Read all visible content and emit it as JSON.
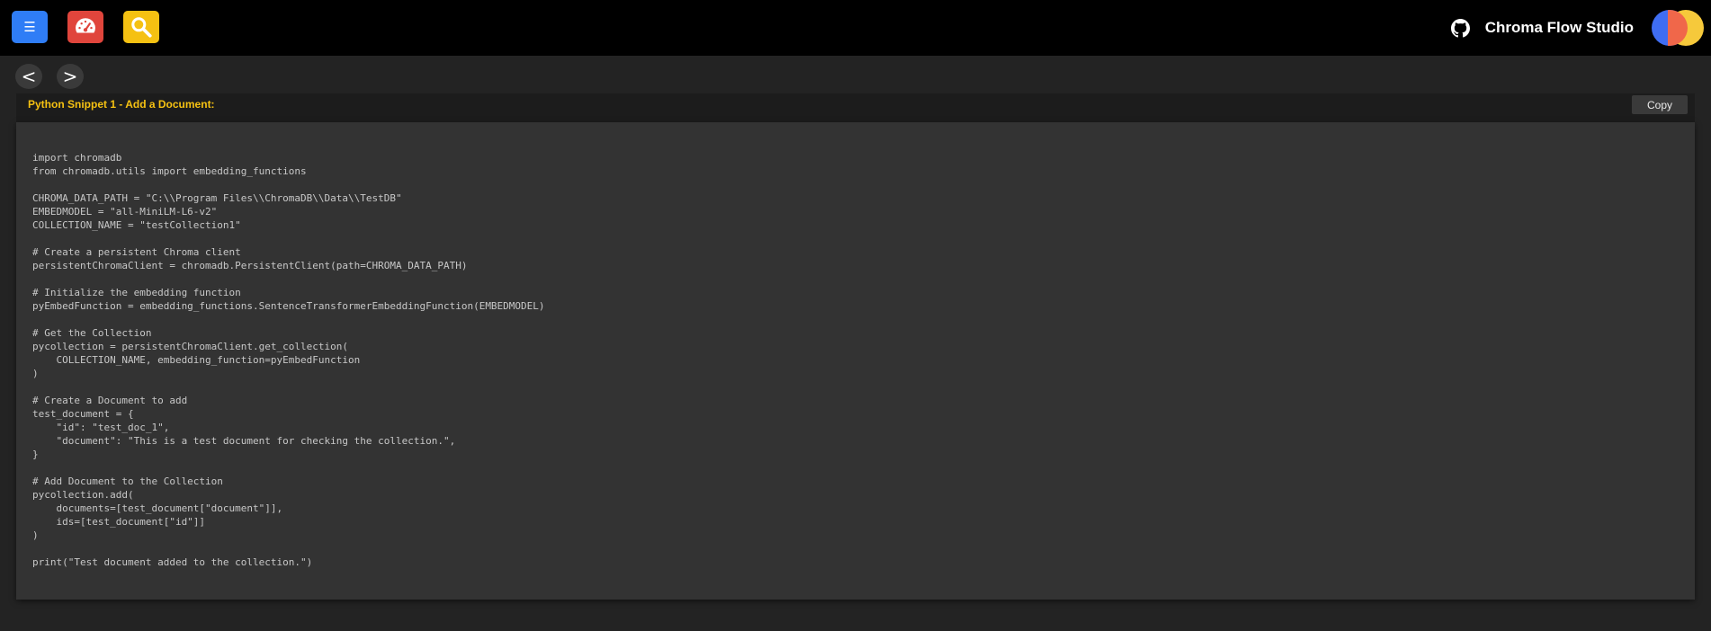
{
  "header": {
    "menu_icon": "menu-icon",
    "dashboard_icon": "dashboard-gauge-icon",
    "search_icon": "search-icon",
    "github_icon": "github-icon",
    "app_title": "Chroma Flow Studio",
    "colors": {
      "menu": "#2f7df6",
      "dashboard": "#e0453c",
      "search": "#f5c112",
      "background": "#000000"
    }
  },
  "nav": {
    "back_label": "<",
    "forward_label": ">"
  },
  "snippet": {
    "title": "Python Snippet 1 - Add a Document:",
    "copy_label": "Copy",
    "title_color": "#f5c112",
    "code": "import chromadb\nfrom chromadb.utils import embedding_functions\n\nCHROMA_DATA_PATH = \"C:\\\\Program Files\\\\ChromaDB\\\\Data\\\\TestDB\"\nEMBEDMODEL = \"all-MiniLM-L6-v2\"\nCOLLECTION_NAME = \"testCollection1\"\n\n# Create a persistent Chroma client\npersistentChromaClient = chromadb.PersistentClient(path=CHROMA_DATA_PATH)\n\n# Initialize the embedding function\npyEmbedFunction = embedding_functions.SentenceTransformerEmbeddingFunction(EMBEDMODEL)\n\n# Get the Collection\npycollection = persistentChromaClient.get_collection(\n    COLLECTION_NAME, embedding_function=pyEmbedFunction\n)\n\n# Create a Document to add\ntest_document = {\n    \"id\": \"test_doc_1\",\n    \"document\": \"This is a test document for checking the collection.\",\n}\n\n# Add Document to the Collection\npycollection.add(\n    documents=[test_document[\"document\"]],\n    ids=[test_document[\"id\"]]\n)\n\nprint(\"Test document added to the collection.\")"
  }
}
